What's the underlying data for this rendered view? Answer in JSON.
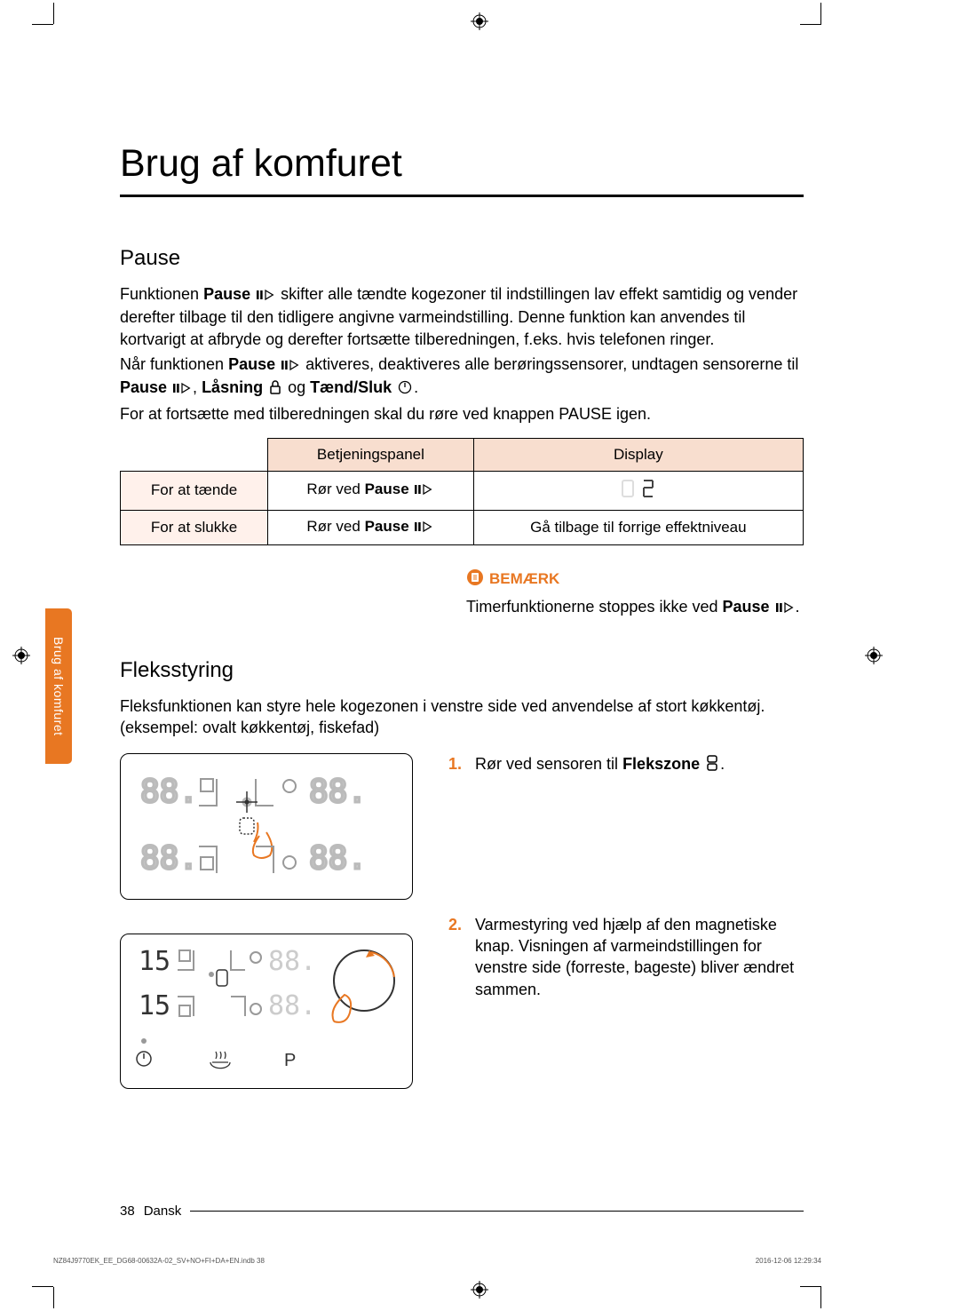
{
  "title": "Brug af komfuret",
  "section_pause": {
    "heading": "Pause",
    "para1_a": "Funktionen ",
    "para1_b": "Pause ",
    "para1_c": " skifter alle tændte kogezoner til indstillingen lav effekt samtidig og vender derefter tilbage til den tidligere angivne varmeindstilling. Denne funktion kan anvendes til kortvarigt at afbryde og derefter fortsætte tilberedningen, f.eks. hvis telefonen ringer.",
    "para2_a": "Når funktionen ",
    "para2_b": "Pause ",
    "para2_c": " aktiveres, deaktiveres alle berøringssensorer, undtagen sensorerne til ",
    "para2_d": "Pause ",
    "para2_e": ", ",
    "para2_f": "Låsning ",
    "para2_g": " og ",
    "para2_h": "Tænd/Sluk ",
    "para2_i": ".",
    "para3": "For at fortsætte med tilberedningen skal du røre ved knappen PAUSE igen.",
    "table": {
      "head_panel": "Betjeningspanel",
      "head_display": "Display",
      "row1_label": "For at tænde",
      "row1_panel": "Rør ved ",
      "row1_panel_b": "Pause ",
      "row1_display": "",
      "row2_label": "For at slukke",
      "row2_panel": "Rør ved ",
      "row2_panel_b": "Pause ",
      "row2_display": "Gå tilbage til forrige effektniveau"
    },
    "note_head": "BEMÆRK",
    "note_text_a": "Timerfunktionerne stoppes ikke ved ",
    "note_text_b": "Pause ",
    "note_text_c": "."
  },
  "section_flex": {
    "heading": "Fleksstyring",
    "intro": "Fleksfunktionen kan styre hele kogezonen i venstre side ved anvendelse af stort køkkentøj. (eksempel: ovalt køkkentøj, fiskefad)",
    "step1_a": "Rør ved sensoren til ",
    "step1_b": "Flekszone ",
    "step1_c": ".",
    "step2": "Varmestyring ved hjælp af den magnetiske knap. Visningen af varmeindstillingen for venstre side (forreste, bageste) bliver ændret sammen."
  },
  "tab_label": "Brug af komfuret",
  "footer": {
    "page": "38",
    "lang": "Dansk"
  },
  "tiny_footer": {
    "left": "NZ84J9770EK_EE_DG68-00632A-02_SV+NO+FI+DA+EN.indb   38",
    "right": "2016-12-06    12:29:34"
  }
}
